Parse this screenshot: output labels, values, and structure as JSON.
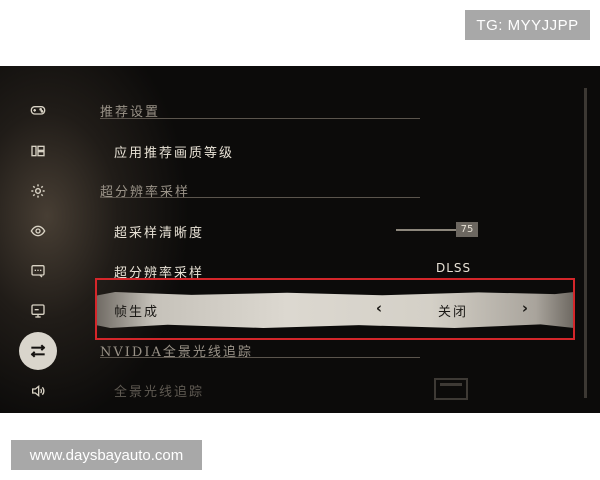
{
  "watermarks": {
    "tag": "TG: MYYJJPP",
    "url": "www.daysbayauto.com"
  },
  "sidebar": {
    "items": [
      {
        "icon": "gamepad-icon",
        "active": false
      },
      {
        "icon": "display-mode-icon",
        "active": false
      },
      {
        "icon": "gear-icon",
        "active": false
      },
      {
        "icon": "eye-icon",
        "active": false
      },
      {
        "icon": "subtitle-icon",
        "active": false
      },
      {
        "icon": "monitor-icon",
        "active": false
      },
      {
        "icon": "sliders-icon",
        "active": true
      },
      {
        "icon": "speaker-icon",
        "active": false
      }
    ]
  },
  "settings": {
    "section_recommended": "推荐设置",
    "apply_recommended": "应用推荐画质等级",
    "section_upscaling": "超分辨率采样",
    "upscale_sharpness_label": "超采样清晰度",
    "upscale_sharpness_value": "75",
    "upscale_sharpness_fraction": 0.75,
    "upscaling_label": "超分辨率采样",
    "upscaling_value": "DLSS",
    "frame_gen_label": "帧生成",
    "frame_gen_value": "关闭",
    "chev_left": "‹",
    "chev_right": "›",
    "section_rt": "NVIDIA全景光线追踪",
    "full_rt_label": "全景光线追踪"
  },
  "colors": {
    "accent_selection": "#d4262a",
    "background": "#0c0b0a",
    "text": "#e8e2d6"
  }
}
